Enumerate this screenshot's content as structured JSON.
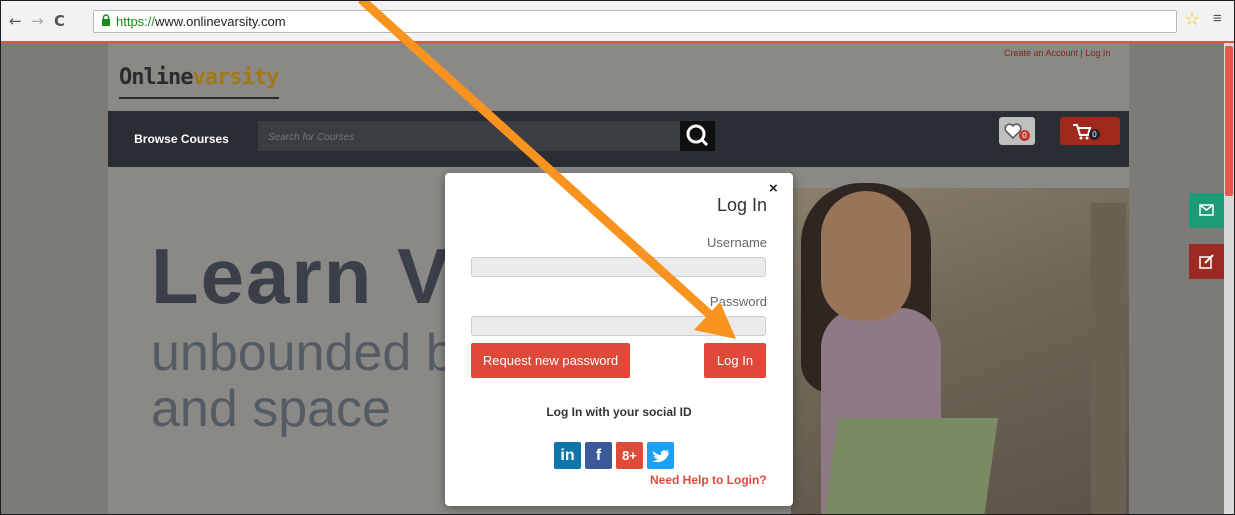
{
  "browser": {
    "url_protocol": "https://",
    "url_domain": "www.onlinevarsity.com",
    "back_icon": "←",
    "forward_icon": "→",
    "reload_icon": "C",
    "star_icon": "☆",
    "menu_icon": "≡"
  },
  "site": {
    "logo_part1": "Online",
    "logo_part2": "varsity",
    "top_links": "Create an Account | Log In"
  },
  "navbar": {
    "browse_label": "Browse Courses",
    "search_placeholder": "Search for Courses",
    "wishlist_count": "0",
    "cart_count": "0"
  },
  "hero": {
    "line1": "Learn Vi",
    "line2": "unbounded by",
    "line3": "and space"
  },
  "modal": {
    "title": "Log In",
    "close_label": "×",
    "username_label": "Username",
    "password_label": "Password",
    "request_password_label": "Request new password",
    "login_button": "Log In",
    "social_heading": "Log In with your social ID",
    "social": [
      {
        "name": "linkedin",
        "glyph": "in",
        "color": "#0e76a8"
      },
      {
        "name": "facebook",
        "glyph": "f",
        "color": "#3b5998"
      },
      {
        "name": "google-plus",
        "glyph": "8+",
        "color": "#dd4b39"
      },
      {
        "name": "twitter",
        "glyph": "t",
        "color": "#1da1f2"
      }
    ],
    "help_link": "Need Help to Login?"
  },
  "colors": {
    "accent_red": "#e0493a",
    "navbar": "#2a2d33",
    "arrow": "#f7931e"
  }
}
